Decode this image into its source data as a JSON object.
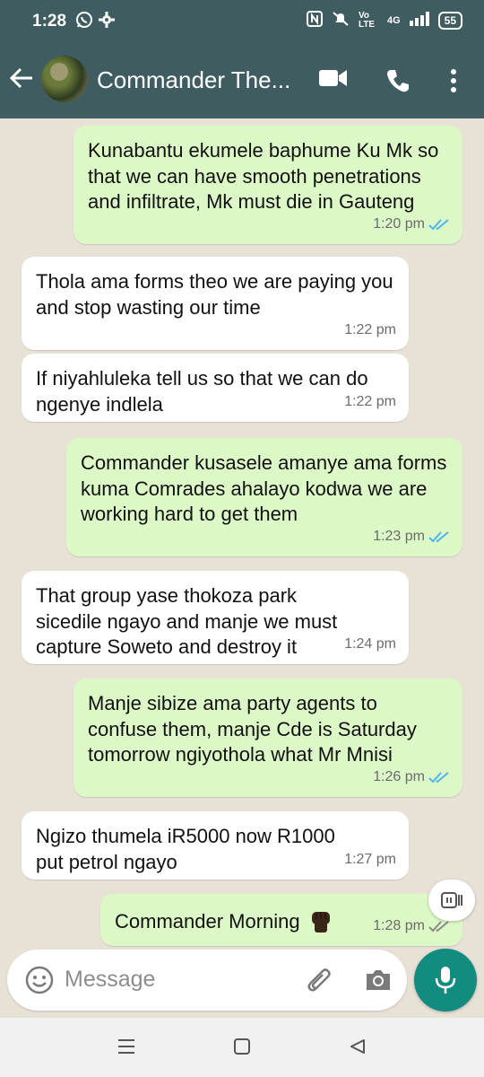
{
  "status": {
    "time": "1:28",
    "volte_label": "Vo LTE",
    "network_label": "4G",
    "battery": "55"
  },
  "header": {
    "back_icon": "arrow-left-icon",
    "contact_name": "Commander The...",
    "video_icon": "video-call-icon",
    "phone_icon": "phone-icon",
    "menu_icon": "more-vert-icon"
  },
  "messages": [
    {
      "dir": "out",
      "text": "Kunabantu ekumele baphume Ku Mk so that we can have smooth penetrations and infiltrate, Mk must die in Gauteng",
      "time": "1:20 pm",
      "status": "read"
    },
    {
      "dir": "in",
      "text": "Thola ama forms theo we are paying you and stop wasting our time",
      "time": "1:22 pm"
    },
    {
      "dir": "in",
      "text": "If niyahluleka tell us so that we can do ngenye indlela",
      "time": "1:22 pm"
    },
    {
      "dir": "out",
      "text": "Commander kusasele amanye ama forms kuma Comrades ahalayo kodwa we are working hard to get them",
      "time": "1:23 pm",
      "status": "read"
    },
    {
      "dir": "in",
      "text": "That group yase thokoza park sicedile ngayo and manje we must capture Soweto and destroy it",
      "time": "1:24 pm"
    },
    {
      "dir": "out",
      "text": "Manje sibize ama party agents to confuse them, manje Cde is Saturday tomorrow ngiyothola what Mr Mnisi",
      "time": "1:26 pm",
      "status": "read"
    },
    {
      "dir": "in",
      "text": "Ngizo thumela iR5000 now R1000 put petrol ngayo",
      "time": "1:27 pm"
    },
    {
      "dir": "out",
      "text": "Commander Morning",
      "emoji": "raised-fist-emoji",
      "time": "1:28 pm",
      "status": "delivered"
    }
  ],
  "composer": {
    "placeholder": "Message",
    "emoji_icon": "emoji-icon",
    "attach_icon": "paperclip-icon",
    "camera_icon": "camera-icon",
    "mic_icon": "microphone-icon"
  },
  "colors": {
    "header": "#3f5d61",
    "outgoing_bubble": "#dcf8c6",
    "incoming_bubble": "#ffffff",
    "chat_background": "#e8e1d6",
    "read_ticks": "#4fb6ec",
    "accent": "#128c7e"
  }
}
